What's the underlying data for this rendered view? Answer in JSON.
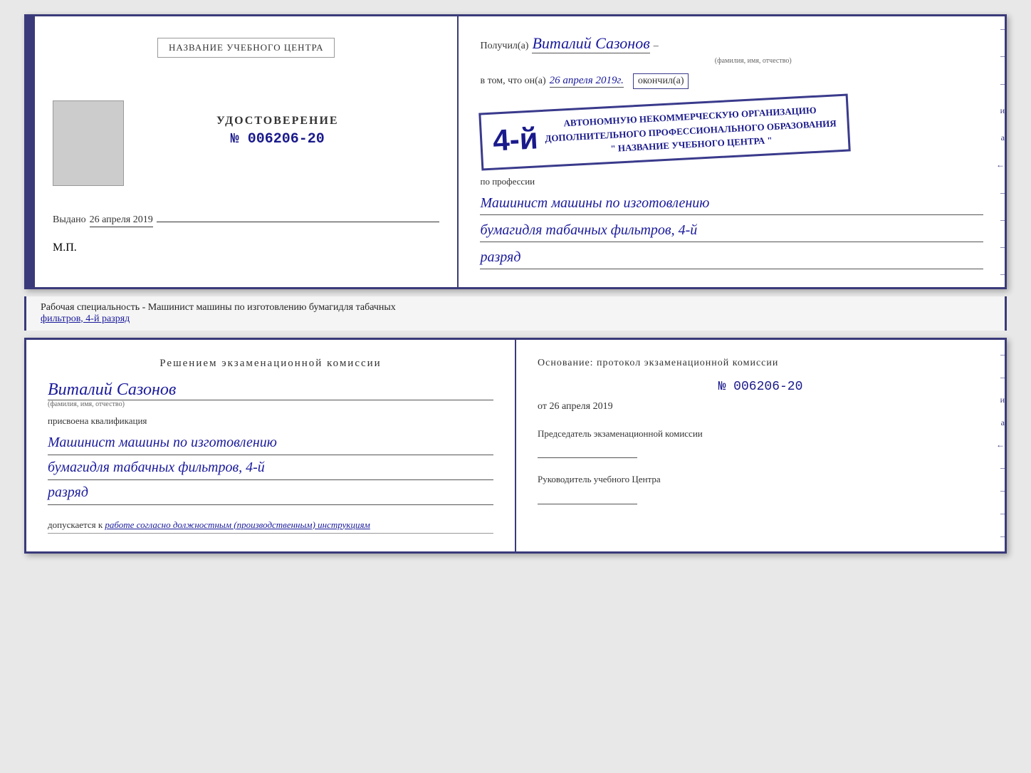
{
  "top_book": {
    "left": {
      "org_name_label": "НАЗВАНИЕ УЧЕБНОГО ЦЕНТРА",
      "udostoverenie_label": "УДОСТОВЕРЕНИЕ",
      "number": "№ 006206-20",
      "vydano_prefix": "Выдано",
      "vydano_date": "26 апреля 2019",
      "mp_label": "М.П."
    },
    "right": {
      "poluchil_prefix": "Получил(а)",
      "recipient_name": "Виталий Сазонов",
      "recipient_hint": "(фамилия, имя, отчество)",
      "vtom_prefix": "в том, что он(а)",
      "vtom_date": "26 апреля 2019г.",
      "okончил_label": "окончил(а)",
      "stamp_number": "4-й",
      "stamp_line1": "АВТОНОМНУЮ НЕКОММЕРЧЕСКУЮ ОРГАНИЗАЦИЮ",
      "stamp_line2": "ДОПОЛНИТЕЛЬНОГО ПРОФЕССИОНАЛЬНОГО ОБРАЗОВАНИЯ",
      "stamp_line3": "\" НАЗВАНИЕ УЧЕБНОГО ЦЕНТРА \"",
      "profession_prefix": "по профессии",
      "profession_line1": "Машинист машины по изготовлению",
      "profession_line2": "бумагидля табачных фильтров, 4-й",
      "profession_line3": "разряд"
    }
  },
  "info_strip": {
    "text_prefix": "Рабочая специальность - Машинист машины по изготовлению бумагидля табачных",
    "text_underline": "фильтров, 4-й разряд"
  },
  "bottom_book": {
    "left": {
      "resheniyem_title": "Решением  экзаменационной  комиссии",
      "name": "Виталий Сазонов",
      "name_hint": "(фамилия, имя, отчество)",
      "prisvoena_label": "присвоена квалификация",
      "qualification_line1": "Машинист машины по изготовлению",
      "qualification_line2": "бумагидля табачных фильтров, 4-й",
      "qualification_line3": "разряд",
      "dopuskaetsya_prefix": "допускается к",
      "dopuskaetsya_text": "работе согласно должностным (производственным) инструкциям"
    },
    "right": {
      "osnovaniye_label": "Основание: протокол экзаменационной  комиссии",
      "protocol_number": "№ 006206-20",
      "ot_prefix": "от",
      "ot_date": "26 апреля 2019",
      "predsedatel_label": "Председатель экзаменационной комиссии",
      "rukovoditel_label": "Руководитель учебного Центра"
    }
  },
  "side_decorations": [
    "–",
    "–",
    "–",
    "и",
    "а",
    "←",
    "–",
    "–",
    "–",
    "–"
  ],
  "side_decorations_bottom": [
    "–",
    "–",
    "и",
    "а",
    "←",
    "–",
    "–",
    "–",
    "–"
  ]
}
